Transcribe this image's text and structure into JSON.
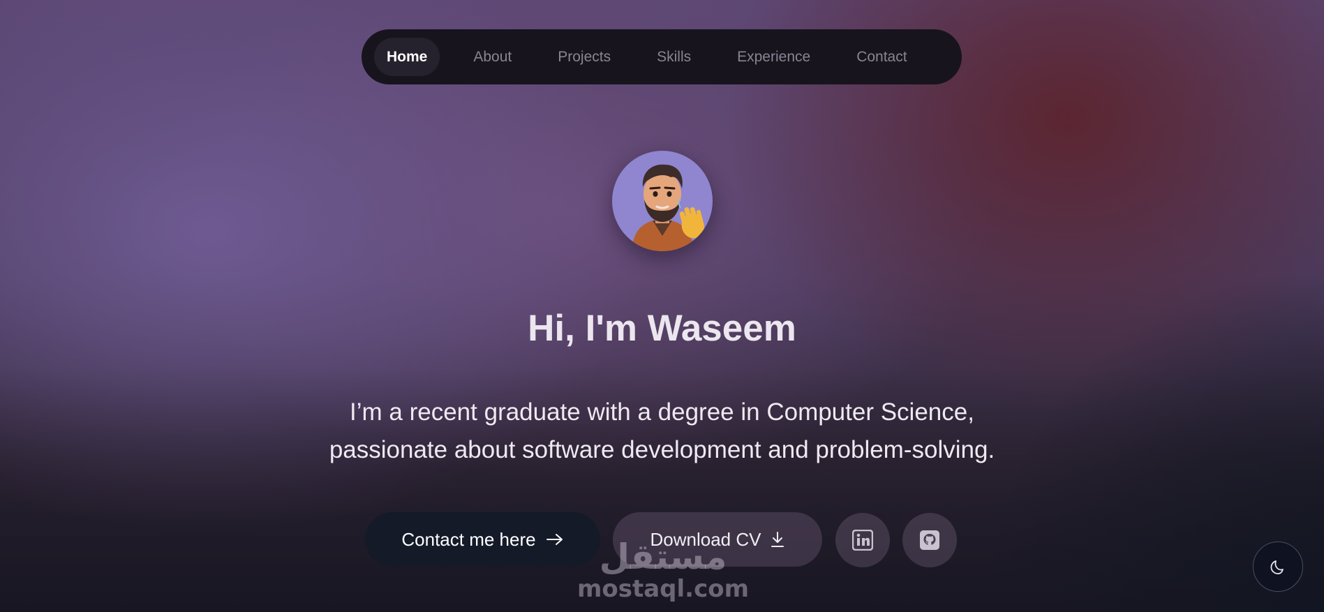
{
  "nav": {
    "items": [
      {
        "label": "Home",
        "active": true
      },
      {
        "label": "About"
      },
      {
        "label": "Projects"
      },
      {
        "label": "Skills"
      },
      {
        "label": "Experience"
      },
      {
        "label": "Contact"
      }
    ]
  },
  "hero": {
    "greeting": "Hi, I'm Waseem",
    "intro_line1": "I’m a recent graduate with a degree in Computer Science,",
    "intro_line2": "passionate about software development and problem-solving."
  },
  "actions": {
    "contact_label": "Contact me here",
    "download_label": "Download CV",
    "icons": [
      "arrow-right-icon",
      "download-icon",
      "linkedin-icon",
      "github-icon",
      "moon-icon"
    ]
  },
  "watermark": {
    "arabic": "مستقل",
    "latin": "mostaql.com"
  },
  "colors": {
    "nav_background": "#17141d",
    "primary_button": "#141a28",
    "avatar_background": "#8f86cf"
  }
}
